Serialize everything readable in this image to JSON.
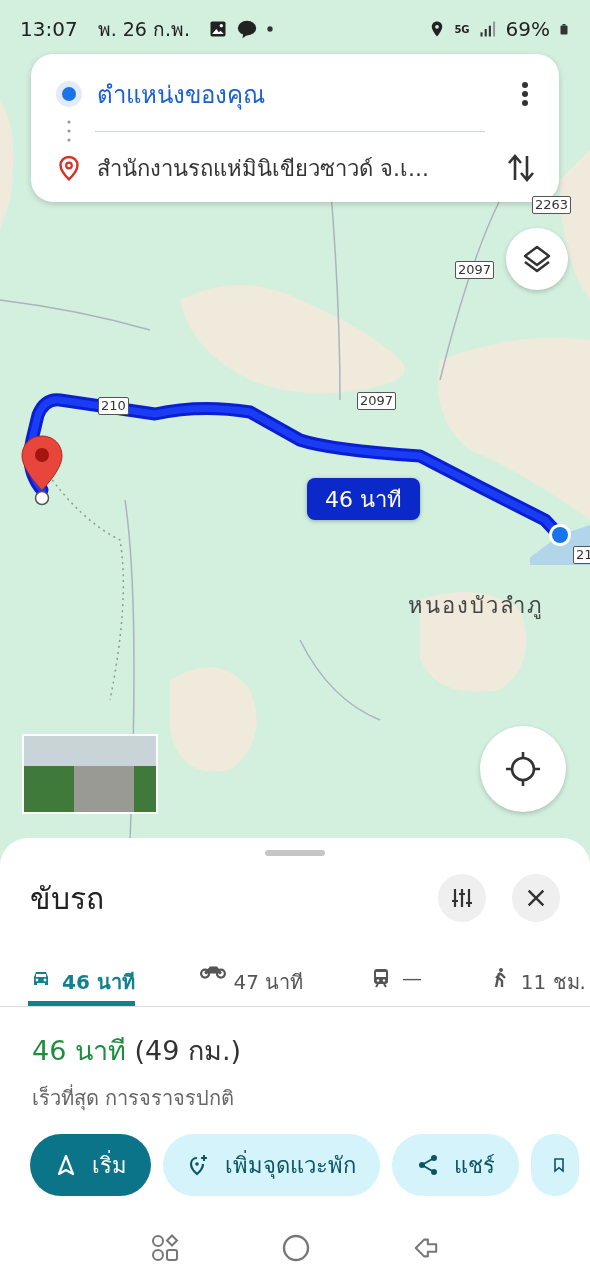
{
  "status_bar": {
    "time": "13:07",
    "date": "พ. 26 ก.พ.",
    "network": "5G",
    "battery": "69%"
  },
  "directions": {
    "origin": "ตำแหน่งของคุณ",
    "destination": "สำนักงานรถแห่มินิเขียวซาวด์ จ.เ..."
  },
  "map": {
    "road_labels": [
      {
        "text": "2263"
      },
      {
        "text": "2097"
      },
      {
        "text": "210"
      },
      {
        "text": "2097"
      },
      {
        "text": "21"
      }
    ],
    "place_label": "หนองบัวลำภู",
    "route_bubble": "46 นาที"
  },
  "sheet": {
    "title": "ขับรถ",
    "modes": [
      {
        "kind": "car",
        "label": "46 นาที",
        "selected": true
      },
      {
        "kind": "motorcycle",
        "label": "47 นาที",
        "selected": false
      },
      {
        "kind": "train",
        "label": "—",
        "selected": false
      },
      {
        "kind": "walk",
        "label": "11 ชม.",
        "selected": false
      }
    ],
    "summary": {
      "duration": "46 นาที",
      "distance": "(49 กม.)",
      "note": "เร็วที่สุด การจราจรปกติ"
    },
    "actions": [
      {
        "kind": "start",
        "label": "เริ่ม"
      },
      {
        "kind": "add-stop",
        "label": "เพิ่มจุดแวะพัก"
      },
      {
        "kind": "share",
        "label": "แชร์"
      },
      {
        "kind": "save"
      }
    ]
  }
}
